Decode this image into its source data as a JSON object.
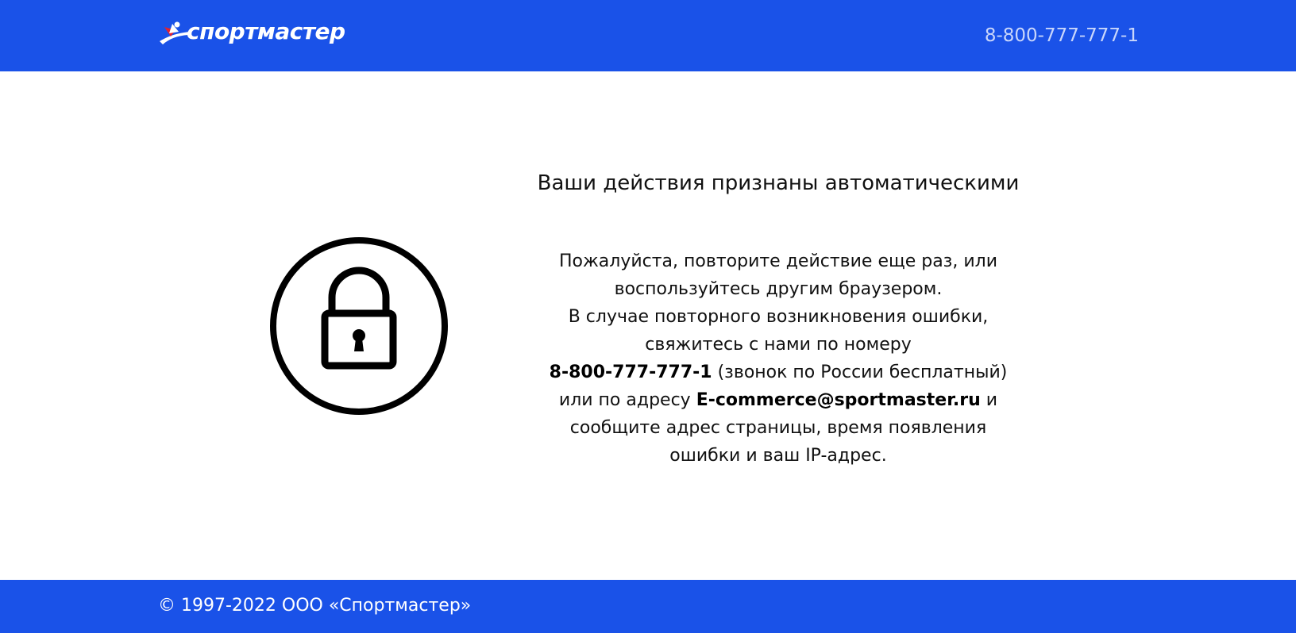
{
  "header": {
    "logo_text": "спортмастер",
    "phone": "8-800-777-777-1"
  },
  "main": {
    "title": "Ваши действия признаны автоматическими",
    "message": {
      "line1": "Пожалуйста, повторите действие еще раз, или",
      "line2": "воспользуйтесь другим браузером.",
      "line3": "В случае повторного возникновения ошибки,",
      "line4": "свяжитесь с нами по номеру",
      "phone_bold": "8-800-777-777-1",
      "phone_note": " (звонок по России бесплатный)",
      "address_prefix": "или по адресу ",
      "email_bold": "E-commerce@sportmaster.ru",
      "address_suffix": " и",
      "line7": "сообщите адрес страницы, время появления",
      "line8": "ошибки и ваш IP-адрес."
    },
    "icon": "lock-icon"
  },
  "footer": {
    "copyright": "© 1997-2022 ООО «Спортмастер»"
  },
  "colors": {
    "brand_blue": "#1a52e8",
    "logo_red": "#e4202e",
    "text": "#111111"
  }
}
